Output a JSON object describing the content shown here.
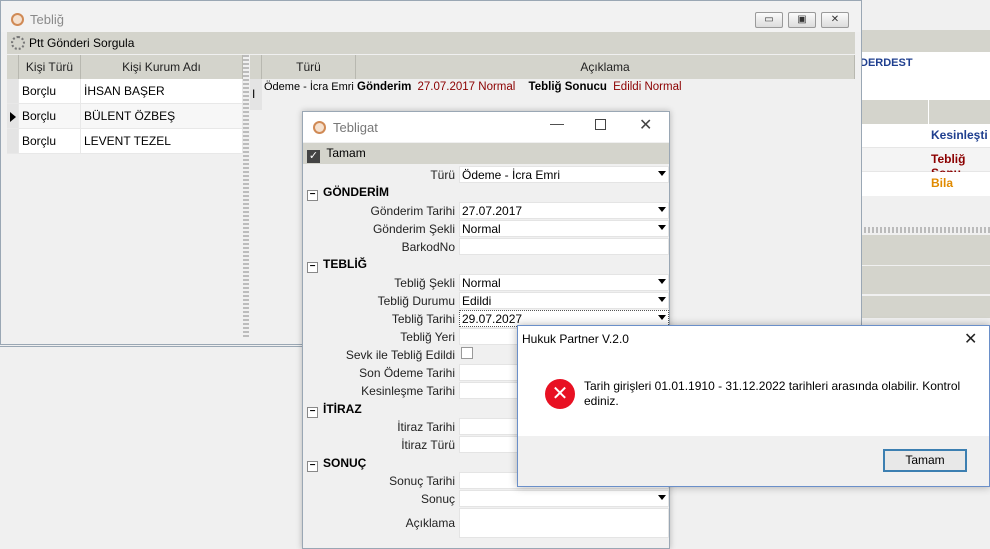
{
  "background": {
    "header_text": "DERDEST",
    "rows": [
      "Kesinleşti",
      "Tebliğ Sonu",
      "Bila"
    ],
    "row_colors": [
      "#1f3f8f",
      "#8b0000",
      "#e08a00"
    ]
  },
  "main_window": {
    "title": "Tebliğ",
    "ptt_query_label": "Ptt Gönderi Sorgula",
    "left_grid": {
      "columns": [
        "Kişi Türü",
        "Kişi Kurum Adı"
      ],
      "rows": [
        [
          "Borçlu",
          "İHSAN BAŞER"
        ],
        [
          "Borçlu",
          "BÜLENT ÖZBEŞ"
        ],
        [
          "Borçlu",
          "LEVENT TEZEL"
        ]
      ]
    },
    "right_grid": {
      "columns": [
        "Türü",
        "Açıklama"
      ],
      "row": {
        "turu": "Ödeme - İcra Emri",
        "gonderim_label": "Gönderim",
        "gonderim_date": "27.07.2017",
        "gonderim_type": "Normal",
        "teblig_label": "Tebliğ Sonucu",
        "teblig_status": "Edildi",
        "teblig_type": "Normal"
      }
    }
  },
  "dialog": {
    "title": "Tebligat",
    "tamam_label": "Tamam",
    "turu_label": "Türü",
    "turu_value": "Ödeme - İcra Emri",
    "sections": {
      "gonderim": "GÖNDERİM",
      "teblig": "TEBLİĞ",
      "itiraz": "İTİRAZ",
      "sonuc": "SONUÇ"
    },
    "fields": {
      "gonderim_tarihi_label": "Gönderim Tarihi",
      "gonderim_tarihi": "27.07.2017",
      "gonderim_sekli_label": "Gönderim Şekli",
      "gonderim_sekli": "Normal",
      "barkod_label": "BarkodNo",
      "teblig_sekli_label": "Tebliğ Şekli",
      "teblig_sekli": "Normal",
      "teblig_durumu_label": "Tebliğ Durumu",
      "teblig_durumu": "Edildi",
      "teblig_tarihi_label": "Tebliğ Tarihi",
      "teblig_tarihi": "29.07.2027",
      "teblig_yeri_label": "Tebliğ Yeri",
      "sevk_label": "Sevk ile Tebliğ Edildi",
      "son_odeme_label": "Son Ödeme Tarihi",
      "kesinlesme_label": "Kesinleşme Tarihi",
      "itiraz_tarihi_label": "İtiraz Tarihi",
      "itiraz_turu_label": "İtiraz Türü",
      "sonuc_tarihi_label": "Sonuç Tarihi",
      "sonuc_label": "Sonuç",
      "aciklama_label": "Açıklama"
    }
  },
  "message_box": {
    "title": "Hukuk Partner V.2.0",
    "message": "Tarih girişleri 01.01.1910 - 31.12.2022 tarihleri arasında olabilir. Kontrol ediniz.",
    "ok_label": "Tamam",
    "error_color": "#e81123"
  }
}
